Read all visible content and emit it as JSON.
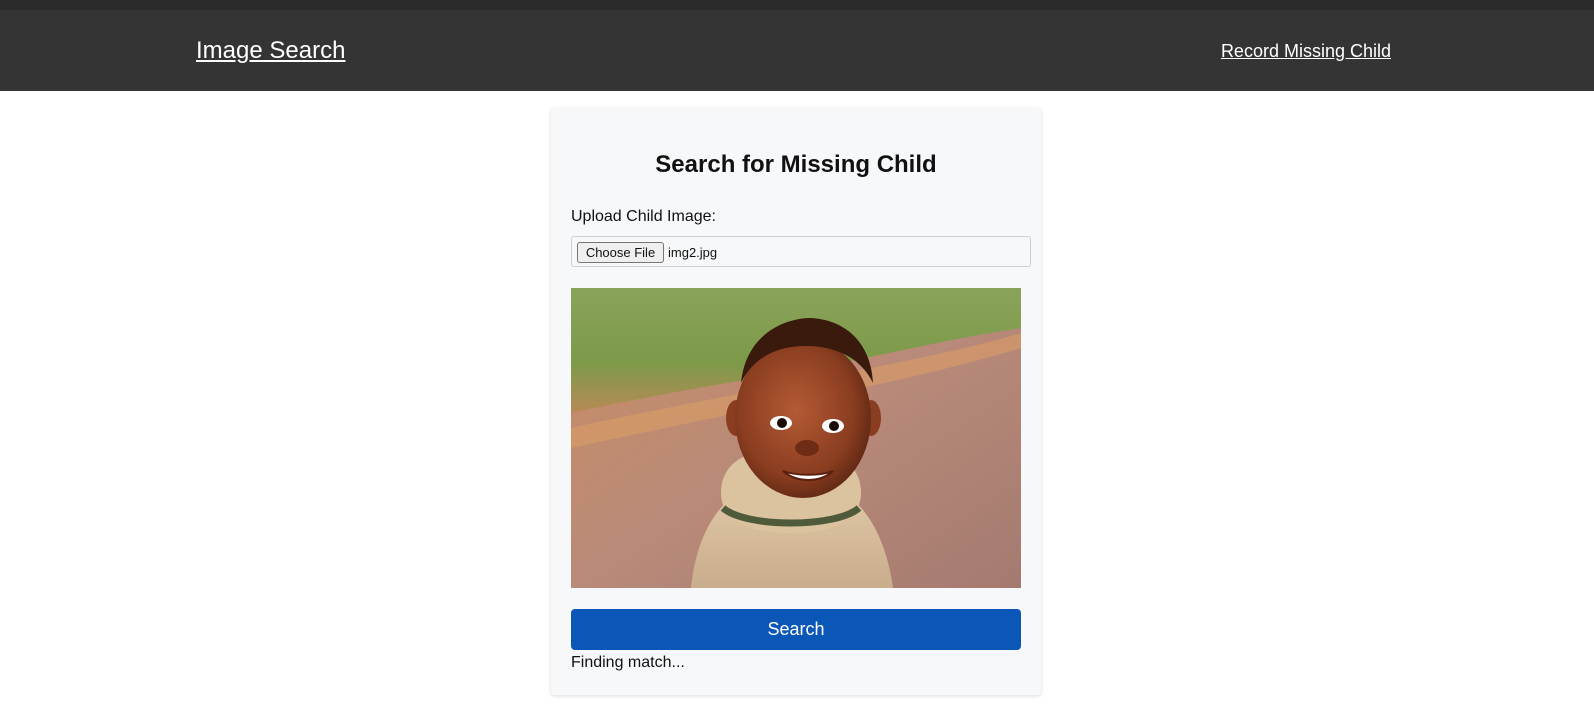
{
  "header": {
    "brand": "Image Search",
    "nav_link": "Record Missing Child"
  },
  "form": {
    "title": "Search for Missing Child",
    "upload_label": "Upload Child Image:",
    "choose_file_label": "Choose File",
    "file_name": "img2.jpg",
    "search_button_label": "Search",
    "status_text": "Finding match..."
  },
  "colors": {
    "header_bg": "#343434",
    "card_bg": "#f7f8fa",
    "button_bg": "#0b57b8"
  }
}
